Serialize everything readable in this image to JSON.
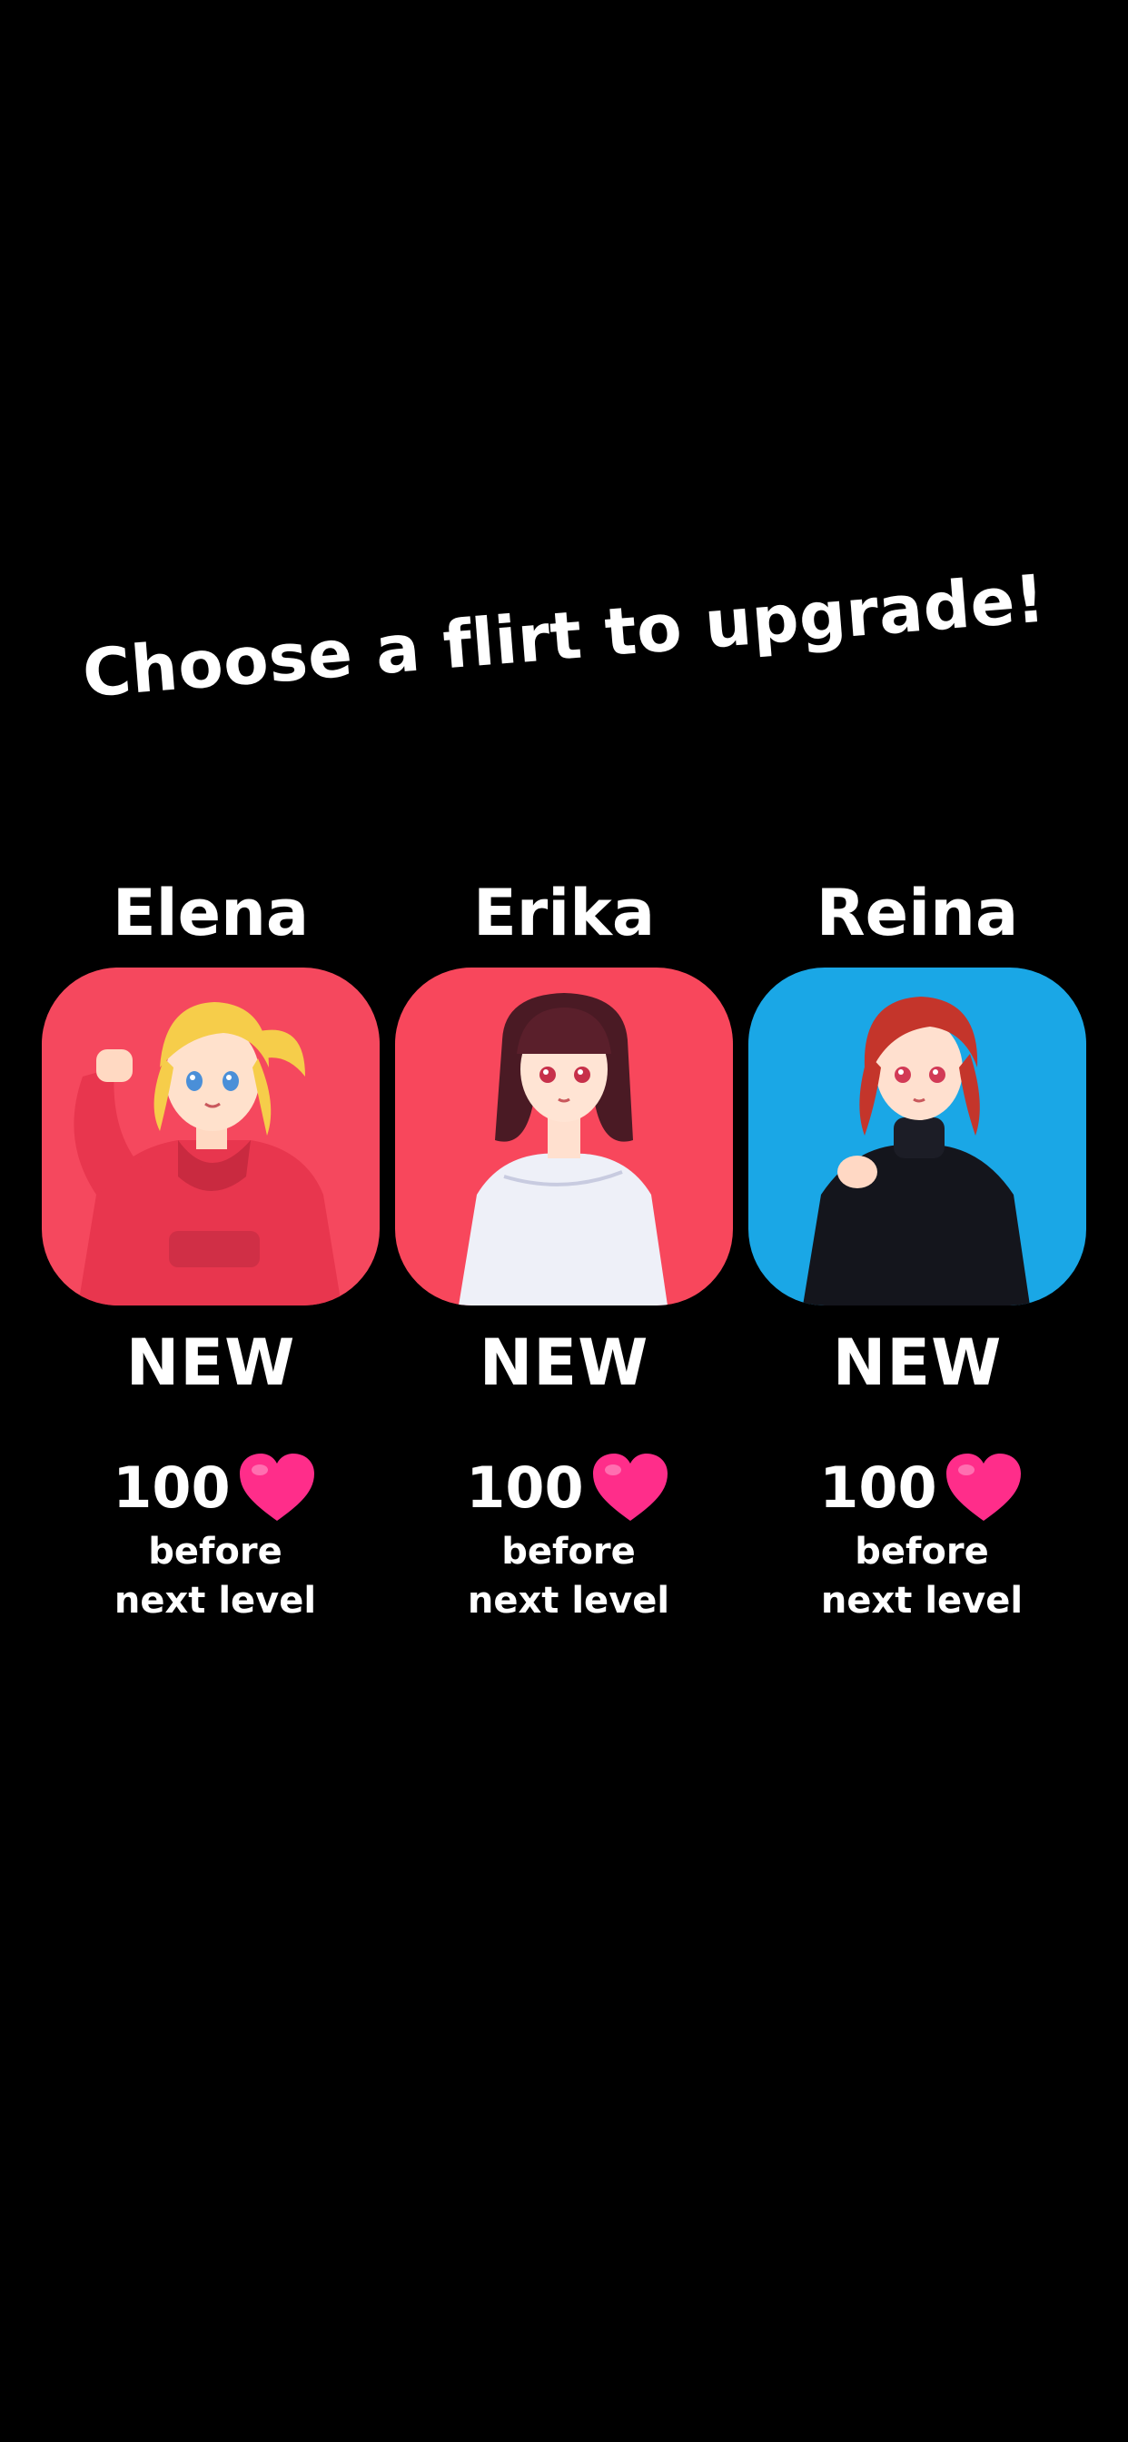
{
  "title": "Choose a flirt to upgrade!",
  "colors": {
    "background": "#000000",
    "text": "#ffffff",
    "heart": "#ff2d8a",
    "elena_bg": "#f5485e",
    "erika_bg": "#f8475c",
    "reina_bg": "#1aa7e6"
  },
  "characters": [
    {
      "name": "Elena",
      "status": "NEW",
      "points": "100",
      "caption_line1": "before",
      "caption_line2": "next level",
      "icon": "heart-icon"
    },
    {
      "name": "Erika",
      "status": "NEW",
      "points": "100",
      "caption_line1": "before",
      "caption_line2": "next level",
      "icon": "heart-icon"
    },
    {
      "name": "Reina",
      "status": "NEW",
      "points": "100",
      "caption_line1": "before",
      "caption_line2": "next level",
      "icon": "heart-icon"
    }
  ]
}
